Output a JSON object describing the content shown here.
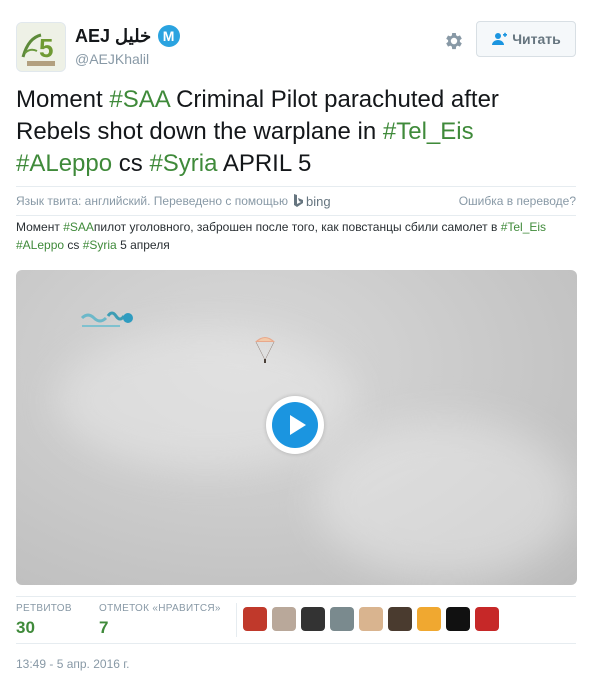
{
  "author": {
    "display_name": "AEJ خليل",
    "badge_letter": "M",
    "handle": "@AEJKhalil"
  },
  "follow_button": {
    "label": "Читать",
    "icon": "add-user-icon"
  },
  "tweet": {
    "segments": [
      {
        "text": "Moment ",
        "hashtag": false
      },
      {
        "text": "#SAA",
        "hashtag": true
      },
      {
        "text": " Criminal Pilot parachuted after Rebels shot down the warplane in ",
        "hashtag": false
      },
      {
        "text": "#Tel_Eis",
        "hashtag": true
      },
      {
        "text": " ",
        "hashtag": false
      },
      {
        "text": "#ALeppo",
        "hashtag": true
      },
      {
        "text": " cs ",
        "hashtag": false
      },
      {
        "text": "#Syria",
        "hashtag": true
      },
      {
        "text": " APRIL 5",
        "hashtag": false
      }
    ]
  },
  "translation": {
    "bar_text": "Язык твита: английский. Переведено с помощью",
    "provider": "bing",
    "error_link": "Ошибка в переводе?",
    "segments": [
      {
        "text": "Момент ",
        "hashtag": false
      },
      {
        "text": "#SAA",
        "hashtag": true
      },
      {
        "text": "пилот уголовного, заброшен после того, как повстанцы сбили самолет в ",
        "hashtag": false
      },
      {
        "text": "#Tel_Eis",
        "hashtag": true
      },
      {
        "text": " ",
        "hashtag": false
      },
      {
        "text": "#ALeppo",
        "hashtag": true
      },
      {
        "text": " cs ",
        "hashtag": false
      },
      {
        "text": "#Syria",
        "hashtag": true
      },
      {
        "text": " 5 апреля",
        "hashtag": false
      }
    ]
  },
  "video": {
    "play_icon": "play-icon"
  },
  "stats": {
    "retweets_label": "РЕТВИТОВ",
    "retweets_value": "30",
    "likes_label": "ОТМЕТОК «НРАВИТСЯ»",
    "likes_value": "7"
  },
  "likers": [
    {
      "color": "#c0392b"
    },
    {
      "color": "#b9a89a"
    },
    {
      "color": "#333333"
    },
    {
      "color": "#7a8a8e"
    },
    {
      "color": "#d9b48f"
    },
    {
      "color": "#4a3b2f"
    },
    {
      "color": "#f0a830"
    },
    {
      "color": "#111111"
    },
    {
      "color": "#c62828"
    }
  ],
  "timestamp": "13:49 - 5 апр. 2016 г.",
  "colors": {
    "hashtag": "#3f8a3a",
    "accent": "#1b95e0"
  }
}
